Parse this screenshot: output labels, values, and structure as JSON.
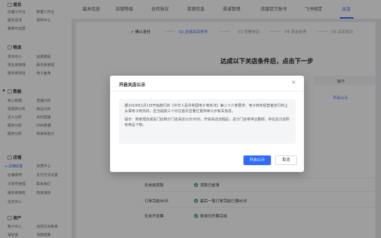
{
  "sidebar": {
    "groups": [
      {
        "title": "首页",
        "items": [
          "店铺工作台",
          "数据工作台",
          "服务请求",
          "规则中心",
          "客服与运营"
        ]
      },
      {
        "title": "物流",
        "items": [
          "发货中心",
          "运费模板",
          "地址库管理",
          "服务商管理",
          "服务商地址",
          "电子面单"
        ]
      },
      {
        "title": "数据",
        "items": [
          "核心数据",
          "直播分析",
          "短视频分析",
          "商品分析",
          "达人分析",
          "实时直播",
          "服务分析",
          "DSR数据",
          "服务分析",
          "商家体验分"
        ]
      },
      {
        "title": "店铺",
        "items": [
          "店铺设置",
          "资质中心",
          "店铺装修",
          "支付方式设置",
          "子账号管理",
          "联系我们",
          "服务商授权",
          "商家授权",
          "任务中心"
        ]
      },
      {
        "title": "资产",
        "items": [
          "账户中心",
          "自然月对账单",
          "保证金",
          "货款结算"
        ]
      }
    ],
    "active_item": "店铺设置"
  },
  "tabs": [
    "基本信息",
    "店铺等级",
    "合同协议",
    "资源信息",
    "渠道管理",
    "店铺官方账号",
    "飞书绑定",
    "关店"
  ],
  "active_tab": "关店",
  "steps": [
    "确认身份",
    "02 达成关店条件",
    "03 签署协议",
    "04 资金处理",
    "05 关店成功"
  ],
  "current_step": 1,
  "headline": "达成以下关店条件后，点击下一步",
  "table": {
    "op_header": "操作",
    "op_link": "开店公示",
    "rows": [
      {
        "label": "无未结货款",
        "status": "货款已结清"
      },
      {
        "label": "订单完结90天",
        "status": "最后一笔订单完结已满90天"
      },
      {
        "label": "无未开发票",
        "status": "账单均开票完成"
      }
    ]
  },
  "modal": {
    "title": "开启关店公示",
    "close_icon": "close-icon",
    "paragraph1": "据2019年1月1日开始施行的《中华人民共和国电子商务法》第二十六条要求：电子商务经营者自行终止从事电子商务的，应当提前三十日在首页显著位置持续公示有关信息。",
    "paragraph2": "提示：商家需完成总门店和分门店关店公示30日。开启关店流程后，总分门店将停业整顿，存在总分店所有商品下架。",
    "confirm": "开启公示",
    "cancel": "取消"
  },
  "colors": {
    "accent": "#2f6bff",
    "success": "#1cb36b"
  }
}
